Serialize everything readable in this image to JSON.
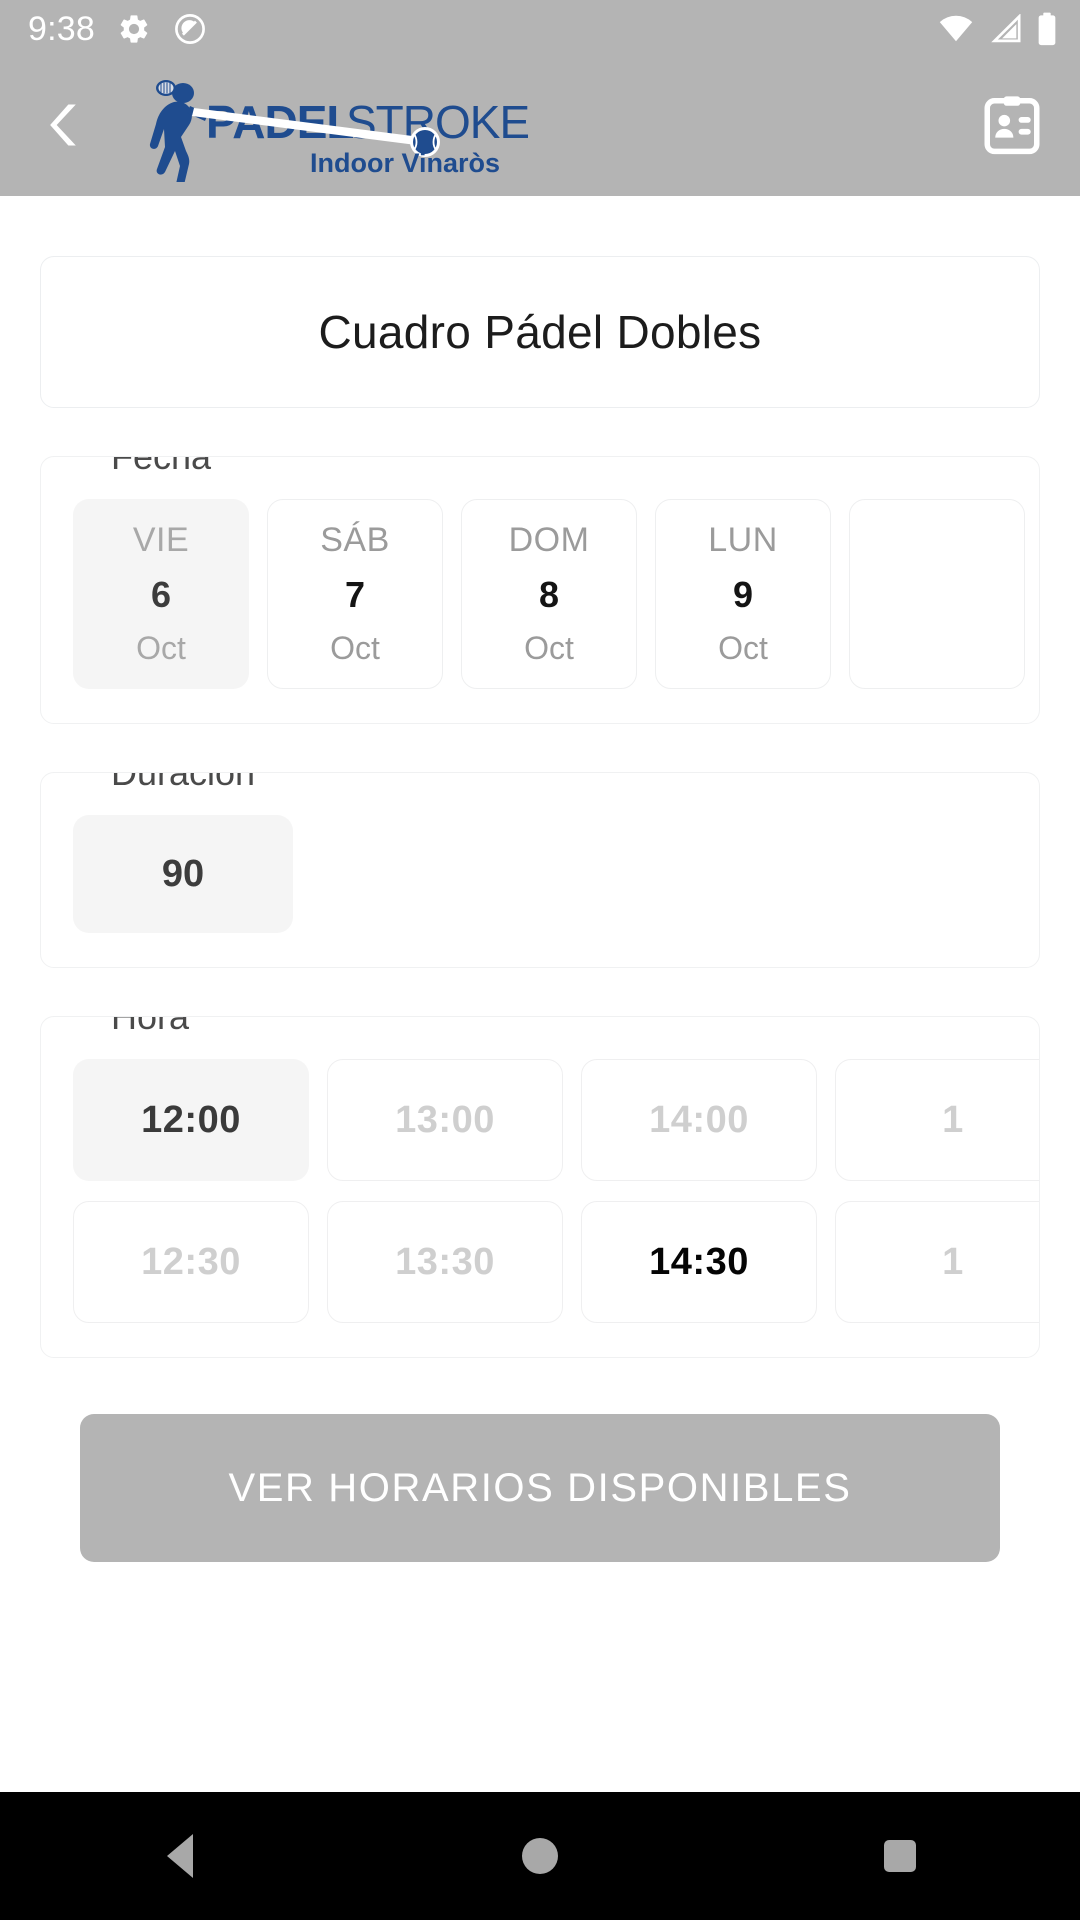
{
  "status_bar": {
    "time": "9:38",
    "icons": [
      "gear-icon",
      "do-not-disturb-icon",
      "wifi-icon",
      "cellular-signal-icon",
      "battery-icon"
    ]
  },
  "header": {
    "back_icon": "back-chevron-icon",
    "contacts_icon": "contact-card-icon",
    "logo": {
      "name_bold": "PADEL",
      "name_light": "STROKE",
      "subtitle": "Indoor Vinaròs",
      "color": "#1f4c8f"
    },
    "background_color": "#b4b4b4"
  },
  "main": {
    "title": "Cuadro Pádel Dobles",
    "date_group": {
      "legend": "Fecha",
      "chips": [
        {
          "dow": "VIE",
          "day": "6",
          "month": "Oct",
          "state": "selected"
        },
        {
          "dow": "SÁB",
          "day": "7",
          "month": "Oct",
          "state": "default"
        },
        {
          "dow": "DOM",
          "day": "8",
          "month": "Oct",
          "state": "default"
        },
        {
          "dow": "LUN",
          "day": "9",
          "month": "Oct",
          "state": "default"
        },
        {
          "dow": "",
          "day": "",
          "month": "",
          "state": "clipped"
        }
      ]
    },
    "duration_group": {
      "legend": "Duración",
      "chips": [
        {
          "label": "90",
          "state": "selected"
        }
      ]
    },
    "hour_group": {
      "legend": "Hora",
      "rows": [
        [
          {
            "label": "12:00",
            "state": "selected"
          },
          {
            "label": "13:00",
            "state": "disabled"
          },
          {
            "label": "14:00",
            "state": "disabled"
          },
          {
            "label": "1",
            "state": "disabled"
          }
        ],
        [
          {
            "label": "12:30",
            "state": "disabled"
          },
          {
            "label": "13:30",
            "state": "disabled"
          },
          {
            "label": "14:30",
            "state": "available"
          },
          {
            "label": "1",
            "state": "disabled"
          }
        ]
      ]
    },
    "primary_button": {
      "label": "VER HORARIOS DISPONIBLES",
      "background_color": "#b4b4b4",
      "text_color": "#ffffff"
    }
  },
  "nav_bar": {
    "back": "nav-back-icon",
    "home": "nav-home-icon",
    "recents": "nav-recents-icon",
    "background_color": "#000000"
  }
}
